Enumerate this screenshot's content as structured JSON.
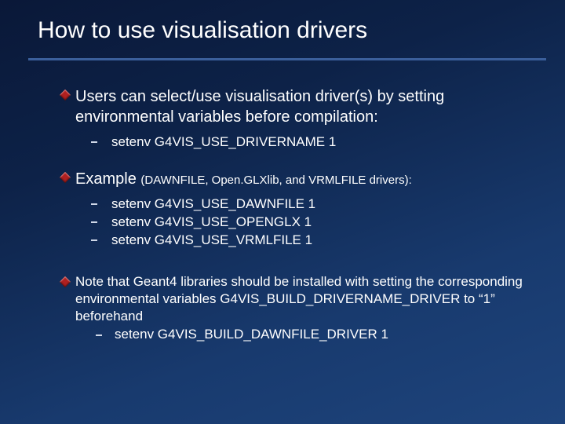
{
  "title": "How to use visualisation drivers",
  "b1": {
    "text": "Users can select/use visualisation driver(s) by setting environmental variables before compilation:",
    "sub1": "setenv  G4VIS_USE_DRIVERNAME   1"
  },
  "b2": {
    "lead": "Example ",
    "paren": "(DAWNFILE, Open.GLXlib, and VRMLFILE drivers):",
    "sub1": "setenv  G4VIS_USE_DAWNFILE    1",
    "sub2": "setenv  G4VIS_USE_OPENGLX     1",
    "sub3": "setenv  G4VIS_USE_VRMLFILE    1"
  },
  "b3": {
    "text": "Note that Geant4 libraries should be installed with setting the corresponding environmental variables G4VIS_BUILD_DRIVERNAME_DRIVER to “1” beforehand",
    "sub1": "setenv  G4VIS_BUILD_DAWNFILE_DRIVER  1"
  }
}
